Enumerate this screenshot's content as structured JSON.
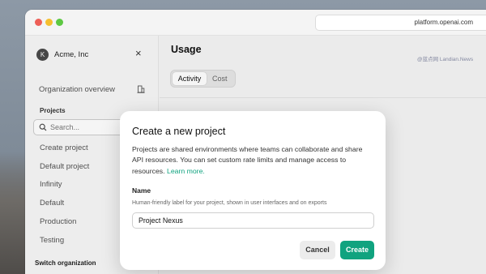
{
  "browser": {
    "url": "platform.openai.com"
  },
  "sidebar": {
    "org_initial": "K",
    "org_name": "Acme, Inc",
    "close_glyph": "×",
    "org_overview": "Organization overview",
    "projects_label": "Projects",
    "search_placeholder": "Search...",
    "items": [
      {
        "label": "Create project"
      },
      {
        "label": "Default project"
      },
      {
        "label": "Infinity"
      },
      {
        "label": "Default"
      },
      {
        "label": "Production"
      },
      {
        "label": "Testing"
      }
    ],
    "switch_org": "Switch organization"
  },
  "main": {
    "title": "Usage",
    "watermark": "@蓝点网 Landian.News",
    "tabs": [
      {
        "label": "Activity",
        "active": true
      },
      {
        "label": "Cost",
        "active": false
      }
    ]
  },
  "modal": {
    "title": "Create a new project",
    "description": "Projects are shared environments where teams can collaborate and share API resources. You can set custom rate limits and manage access to resources.",
    "learn_more": "Learn more.",
    "name_label": "Name",
    "name_help": "Human-friendly label for your project, shown in user interfaces and on exports",
    "name_value": "Project Nexus",
    "cancel_label": "Cancel",
    "create_label": "Create"
  },
  "colors": {
    "accent": "#10a37f",
    "traffic_red": "#ee5f57",
    "traffic_yellow": "#f5bf2f",
    "traffic_green": "#5dc842"
  },
  "icons": [
    "search-icon",
    "building-icon",
    "close-icon"
  ]
}
